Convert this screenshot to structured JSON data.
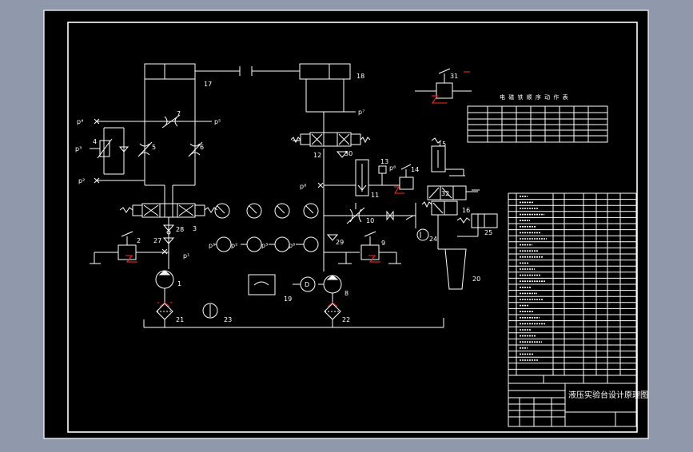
{
  "colors": {
    "viewport": "#8f99ab",
    "sheet": "#000000",
    "line": "#ffffff",
    "accent": "#ff2a2a"
  },
  "labels": {
    "n17": "17",
    "n18": "18",
    "n7": "7",
    "n4": "4",
    "n5": "5",
    "n6": "6",
    "n3": "3",
    "n2": "2",
    "n28": "28",
    "n27": "27",
    "n1": "1",
    "n21": "21",
    "n23": "23",
    "n19": "19",
    "n8": "8",
    "n9": "9",
    "n22": "22",
    "n29": "29",
    "n30": "30",
    "n12": "12",
    "n13": "13",
    "n14": "14",
    "n11": "11",
    "n10": "10",
    "n15": "15",
    "n16": "16",
    "n32": "32",
    "n24": "24",
    "n25": "25",
    "n20": "20",
    "n31": "31",
    "D": "D",
    "p1": "p¹",
    "p2": "p²",
    "p3": "p³",
    "p4": "p⁴",
    "p5": "p⁵",
    "p6": "p⁶",
    "p7": "p⁷",
    "p8": "p⁸"
  },
  "table": {
    "title": "电 磁 铁 顺 序 动 作 表"
  },
  "title_block": {
    "drawing_title": "液压实验台设计原理图"
  }
}
